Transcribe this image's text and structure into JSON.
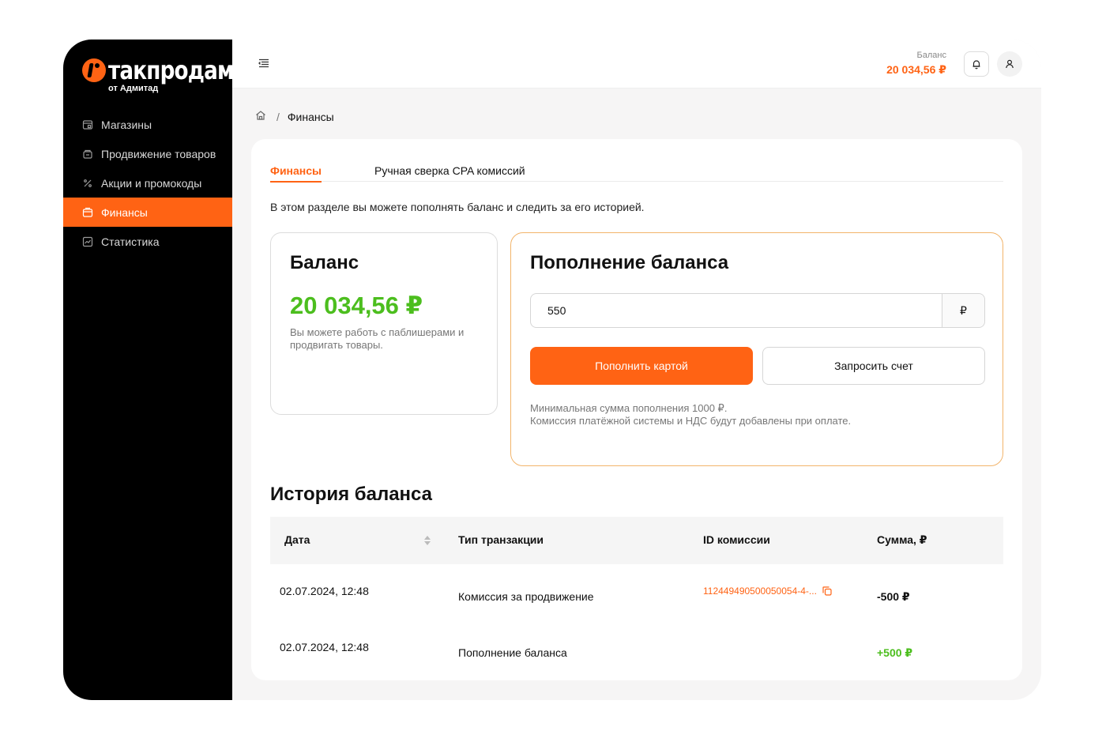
{
  "brand": {
    "name": "такпродам",
    "sub": "от Адмитад"
  },
  "sidebar": {
    "items": [
      {
        "label": "Магазины",
        "icon": "store-icon",
        "active": false
      },
      {
        "label": "Продвижение товаров",
        "icon": "promotion-icon",
        "active": false
      },
      {
        "label": "Акции и промокоды",
        "icon": "percent-icon",
        "active": false
      },
      {
        "label": "Финансы",
        "icon": "wallet-icon",
        "active": true
      },
      {
        "label": "Статистика",
        "icon": "chart-icon",
        "active": false
      }
    ]
  },
  "header": {
    "balance_label": "Баланс",
    "balance_value": "20 034,56 ₽"
  },
  "breadcrumb": {
    "current": "Финансы"
  },
  "tabs": [
    {
      "label": "Финансы",
      "active": true
    },
    {
      "label": "Ручная сверка CPA комиссий",
      "active": false
    }
  ],
  "intro": "В этом разделе вы можете пополнять баланс и следить за его историей.",
  "balance_card": {
    "title": "Баланс",
    "amount": "20 034,56 ₽",
    "description": "Вы можете работь с паблишерами и продвигать товары."
  },
  "topup": {
    "title": "Пополнение баланса",
    "amount_value": "550",
    "currency": "₽",
    "pay_card_label": "Пополнить картой",
    "request_invoice_label": "Запросить счет",
    "note_line1": "Минимальная сумма пополнения 1000 ₽.",
    "note_line2": "Комиссия платёжной системы и НДС будут добавлены при оплате."
  },
  "history": {
    "title": "История баланса",
    "columns": [
      "Дата",
      "Тип транзакции",
      "ID комиссии",
      "Сумма, ₽"
    ],
    "rows": [
      {
        "date": "02.07.2024, 12:48",
        "type": "Комиссия за продвижение",
        "id": "112449490500050054-4-...",
        "sum": "-500 ₽"
      },
      {
        "date": "02.07.2024, 12:48",
        "type": "Пополнение баланса",
        "id": "",
        "sum": "+500 ₽"
      }
    ]
  },
  "colors": {
    "accent": "#ff6314",
    "positive": "#4cbe1e",
    "sidebar_bg": "#000000"
  }
}
